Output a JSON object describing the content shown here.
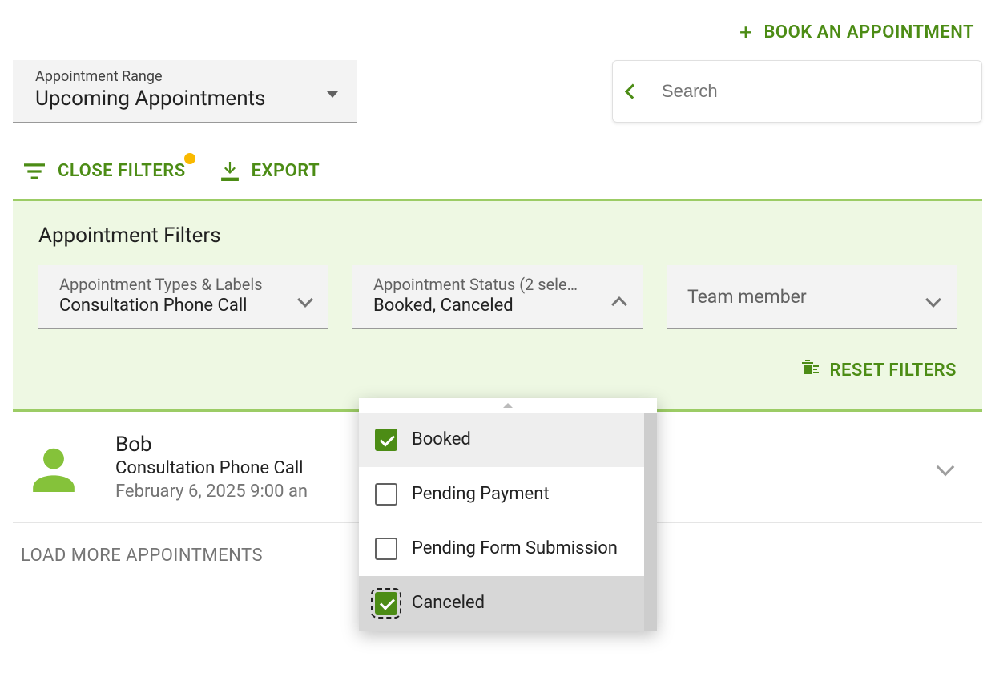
{
  "book_button": "BOOK AN APPOINTMENT",
  "range_dropdown": {
    "label": "Appointment Range",
    "value": "Upcoming Appointments"
  },
  "search": {
    "placeholder": "Search"
  },
  "toolbar": {
    "close_filters": "CLOSE FILTERS",
    "export": "EXPORT"
  },
  "filters": {
    "title": "Appointment Filters",
    "types": {
      "label": "Appointment Types & Labels",
      "value": "Consultation Phone Call"
    },
    "status": {
      "label": "Appointment Status (2 sele…",
      "value": "Booked, Canceled",
      "options": [
        {
          "label": "Booked",
          "checked": true,
          "highlight": true
        },
        {
          "label": "Pending Payment",
          "checked": false
        },
        {
          "label": "Pending Form Submission",
          "checked": false
        },
        {
          "label": "Canceled",
          "checked": true,
          "focused": true,
          "last_highlight": true
        }
      ]
    },
    "team": {
      "placeholder": "Team member"
    },
    "reset": "RESET FILTERS"
  },
  "appointment": {
    "name": "Bob",
    "type": "Consultation Phone Call",
    "time_partial": "February 6, 2025 9:00 an"
  },
  "load_more": "LOAD MORE APPOINTMENTS"
}
